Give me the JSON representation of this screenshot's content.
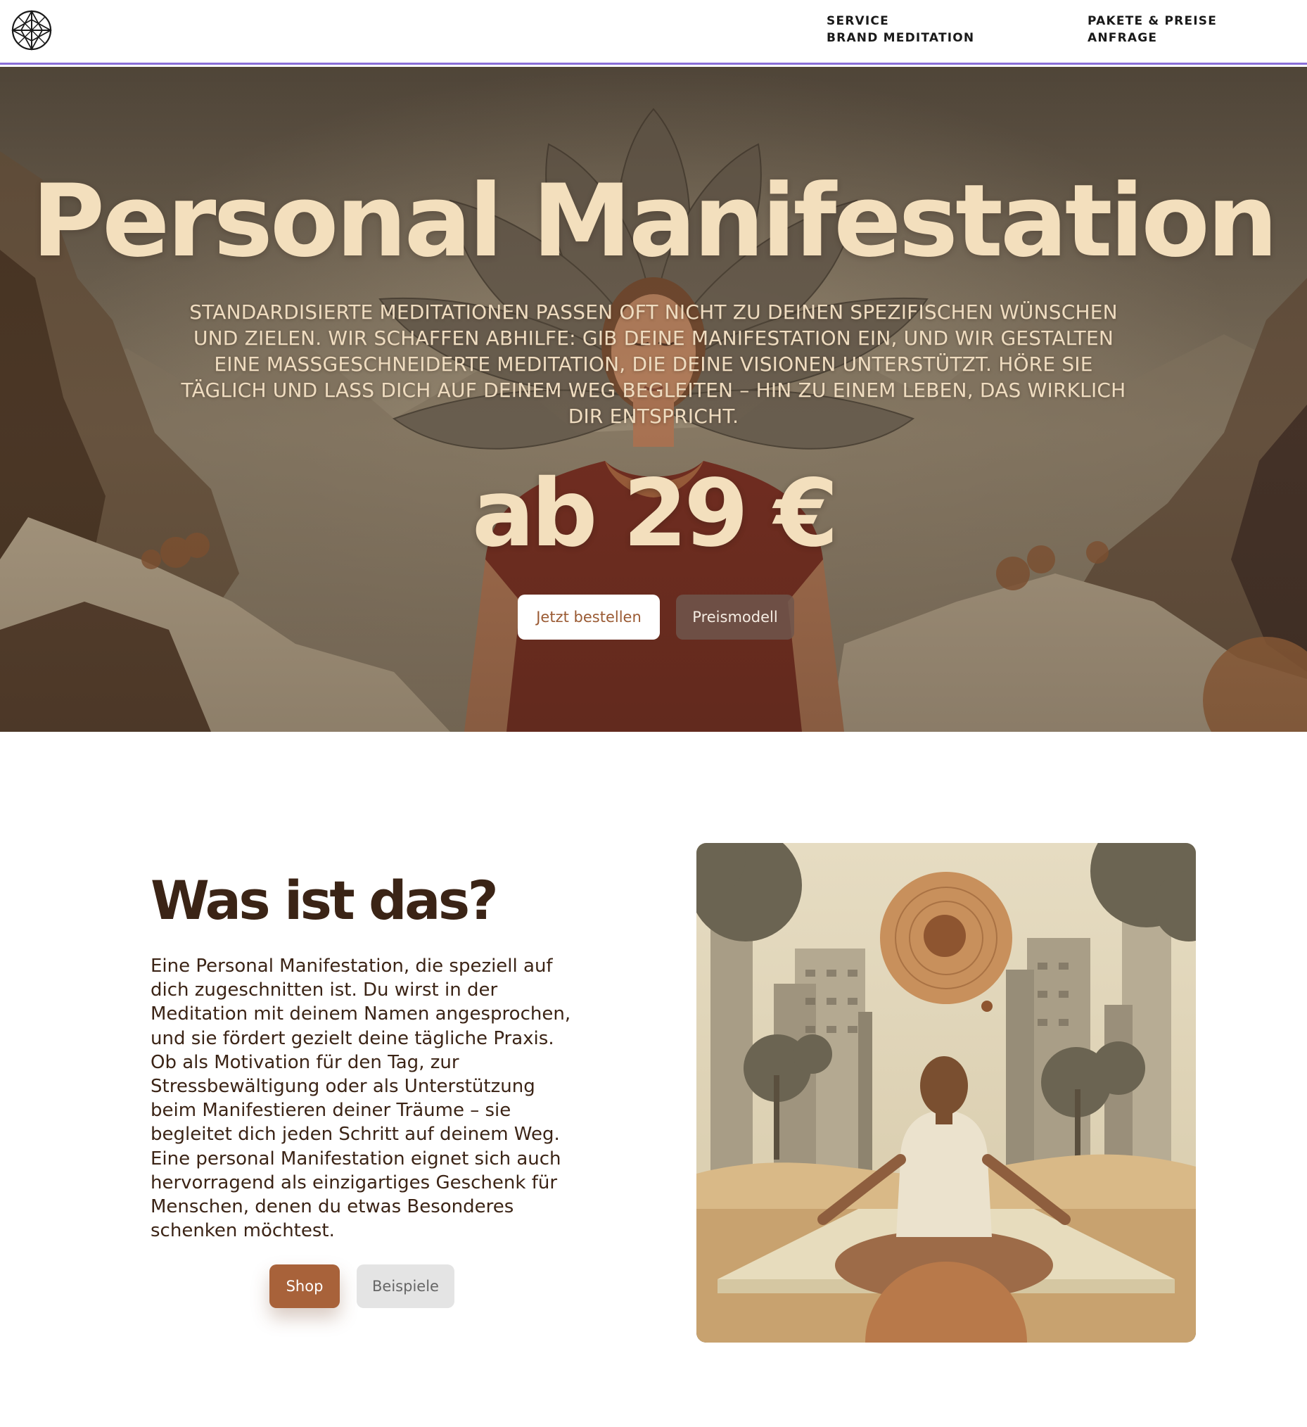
{
  "header": {
    "logo_icon": "mandala-logo-icon",
    "nav": [
      {
        "label": "SERVICE"
      },
      {
        "label": "BRAND MEDITATION"
      },
      {
        "label": "PAKETE & PREISE"
      },
      {
        "label": "ANFRAGE"
      }
    ],
    "border_color": "#8a6fd8"
  },
  "hero": {
    "title": "Personal Manifestation",
    "description": "STANDARDISIERTE MEDITATIONEN PASSEN OFT NICHT ZU DEINEN SPEZIFISCHEN WÜNSCHEN UND ZIELEN. WIR SCHAFFEN ABHILFE: GIB DEINE MANIFESTATION EIN, UND WIR GESTALTEN EINE MASSGESCHNEIDERTE MEDITATION, DIE DEINE VISIONEN UNTERSTÜTZT. HÖRE SIE TÄGLICH UND LASS DICH AUF DEINEM WEG BEGLEITEN – HIN ZU EINEM LEBEN, DAS WIRKLICH DIR ENTSPRICHT.",
    "price": "ab 29 €",
    "primary_button": "Jetzt bestellen",
    "secondary_button": "Preismodell",
    "title_color": "#f3dfbd"
  },
  "about": {
    "title": "Was ist das?",
    "text": "Eine Personal Manifestation, die speziell auf dich zugeschnitten ist. Du wirst in der Meditation mit deinem Namen angesprochen, und sie fördert gezielt deine tägliche Praxis. Ob als Motivation für den Tag, zur Stressbewältigung oder als Unterstützung beim Manifestieren deiner Träume – sie begleitet dich jeden Schritt auf deinem Weg. Eine personal Manifestation eignet sich auch hervorragend als einzigartiges Geschenk für Menschen, denen du etwas Besonderes schenken möchtest.",
    "shop_button": "Shop",
    "examples_button": "Beispiele",
    "accent_color": "#a8623a"
  }
}
